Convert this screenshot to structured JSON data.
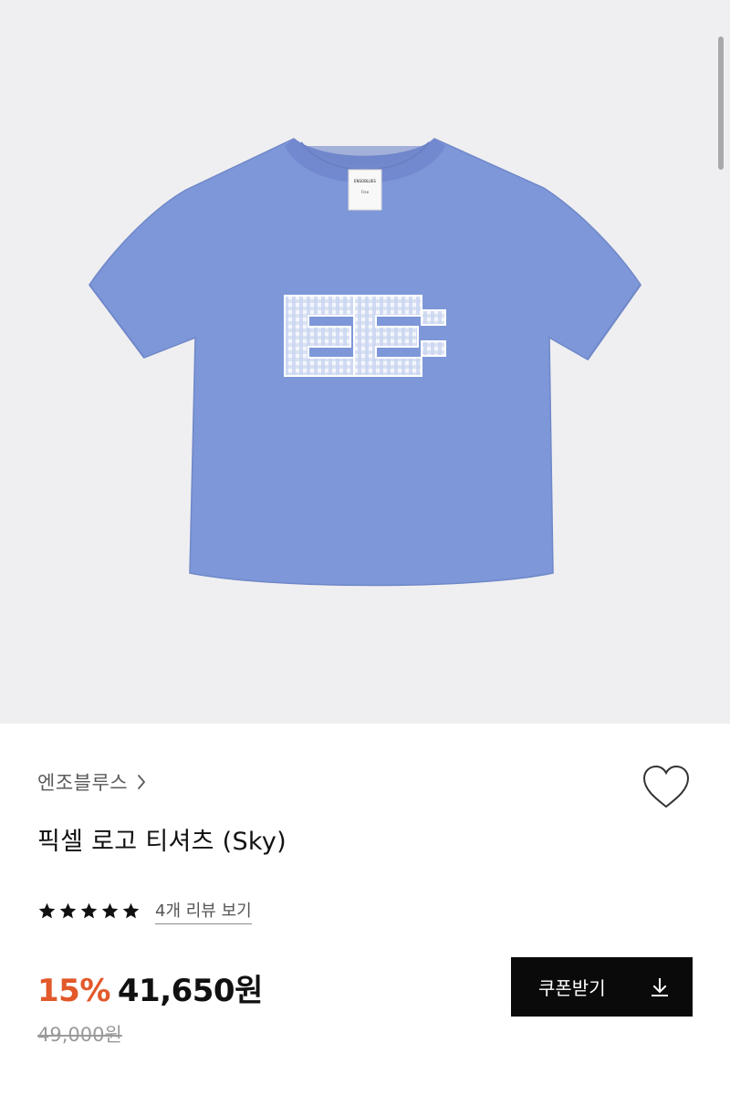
{
  "product": {
    "image": {
      "label_text": "ENSOBLUES",
      "size_text": "Free",
      "colors": {
        "background": "#efeff1",
        "shirt": "#7d97d8",
        "logo": "#f4f6fb"
      }
    },
    "brand": {
      "name": "엔조블루스",
      "chevron_icon": "chevron-right-icon"
    },
    "wishlist_icon": "heart-outline-icon",
    "title": "픽셀 로고 티셔츠 (Sky)",
    "rating": {
      "stars": 5,
      "max_stars": 5,
      "review_link": "4개 리뷰 보기"
    },
    "price": {
      "discount": "15%",
      "sale_price": "41,650원",
      "original_price": "49,000원",
      "discount_color": "#e2592a"
    },
    "coupon_button": {
      "label": "쿠폰받기",
      "icon": "download-icon"
    }
  }
}
